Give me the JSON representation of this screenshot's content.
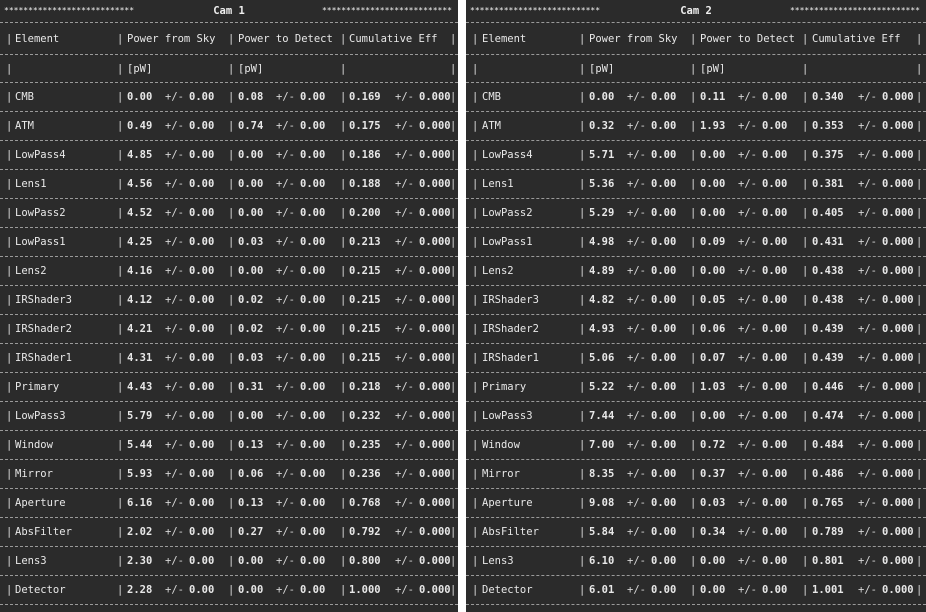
{
  "stars_left": "***************************",
  "stars_right": "***************************",
  "columns": [
    "Element",
    "Power from Sky",
    "Power to Detect",
    "Cumulative Eff"
  ],
  "units": [
    "",
    "[pW]",
    "[pW]",
    ""
  ],
  "pm": "+/-",
  "panels": [
    {
      "title": "Cam 1",
      "rows": [
        {
          "element": "CMB",
          "sky": "0.00",
          "sky_err": "0.00",
          "det": "0.08",
          "det_err": "0.00",
          "eff": "0.169",
          "eff_err": "0.000"
        },
        {
          "element": "ATM",
          "sky": "0.49",
          "sky_err": "0.00",
          "det": "0.74",
          "det_err": "0.00",
          "eff": "0.175",
          "eff_err": "0.000"
        },
        {
          "element": "LowPass4",
          "sky": "4.85",
          "sky_err": "0.00",
          "det": "0.00",
          "det_err": "0.00",
          "eff": "0.186",
          "eff_err": "0.000"
        },
        {
          "element": "Lens1",
          "sky": "4.56",
          "sky_err": "0.00",
          "det": "0.00",
          "det_err": "0.00",
          "eff": "0.188",
          "eff_err": "0.000"
        },
        {
          "element": "LowPass2",
          "sky": "4.52",
          "sky_err": "0.00",
          "det": "0.00",
          "det_err": "0.00",
          "eff": "0.200",
          "eff_err": "0.000"
        },
        {
          "element": "LowPass1",
          "sky": "4.25",
          "sky_err": "0.00",
          "det": "0.03",
          "det_err": "0.00",
          "eff": "0.213",
          "eff_err": "0.000"
        },
        {
          "element": "Lens2",
          "sky": "4.16",
          "sky_err": "0.00",
          "det": "0.00",
          "det_err": "0.00",
          "eff": "0.215",
          "eff_err": "0.000"
        },
        {
          "element": "IRShader3",
          "sky": "4.12",
          "sky_err": "0.00",
          "det": "0.02",
          "det_err": "0.00",
          "eff": "0.215",
          "eff_err": "0.000"
        },
        {
          "element": "IRShader2",
          "sky": "4.21",
          "sky_err": "0.00",
          "det": "0.02",
          "det_err": "0.00",
          "eff": "0.215",
          "eff_err": "0.000"
        },
        {
          "element": "IRShader1",
          "sky": "4.31",
          "sky_err": "0.00",
          "det": "0.03",
          "det_err": "0.00",
          "eff": "0.215",
          "eff_err": "0.000"
        },
        {
          "element": "Primary",
          "sky": "4.43",
          "sky_err": "0.00",
          "det": "0.31",
          "det_err": "0.00",
          "eff": "0.218",
          "eff_err": "0.000"
        },
        {
          "element": "LowPass3",
          "sky": "5.79",
          "sky_err": "0.00",
          "det": "0.00",
          "det_err": "0.00",
          "eff": "0.232",
          "eff_err": "0.000"
        },
        {
          "element": "Window",
          "sky": "5.44",
          "sky_err": "0.00",
          "det": "0.13",
          "det_err": "0.00",
          "eff": "0.235",
          "eff_err": "0.000"
        },
        {
          "element": "Mirror",
          "sky": "5.93",
          "sky_err": "0.00",
          "det": "0.06",
          "det_err": "0.00",
          "eff": "0.236",
          "eff_err": "0.000"
        },
        {
          "element": "Aperture",
          "sky": "6.16",
          "sky_err": "0.00",
          "det": "0.13",
          "det_err": "0.00",
          "eff": "0.768",
          "eff_err": "0.000"
        },
        {
          "element": "AbsFilter",
          "sky": "2.02",
          "sky_err": "0.00",
          "det": "0.27",
          "det_err": "0.00",
          "eff": "0.792",
          "eff_err": "0.000"
        },
        {
          "element": "Lens3",
          "sky": "2.30",
          "sky_err": "0.00",
          "det": "0.00",
          "det_err": "0.00",
          "eff": "0.800",
          "eff_err": "0.000"
        },
        {
          "element": "Detector",
          "sky": "2.28",
          "sky_err": "0.00",
          "det": "0.00",
          "det_err": "0.00",
          "eff": "1.000",
          "eff_err": "0.000"
        }
      ]
    },
    {
      "title": "Cam 2",
      "rows": [
        {
          "element": "CMB",
          "sky": "0.00",
          "sky_err": "0.00",
          "det": "0.11",
          "det_err": "0.00",
          "eff": "0.340",
          "eff_err": "0.000"
        },
        {
          "element": "ATM",
          "sky": "0.32",
          "sky_err": "0.00",
          "det": "1.93",
          "det_err": "0.00",
          "eff": "0.353",
          "eff_err": "0.000"
        },
        {
          "element": "LowPass4",
          "sky": "5.71",
          "sky_err": "0.00",
          "det": "0.00",
          "det_err": "0.00",
          "eff": "0.375",
          "eff_err": "0.000"
        },
        {
          "element": "Lens1",
          "sky": "5.36",
          "sky_err": "0.00",
          "det": "0.00",
          "det_err": "0.00",
          "eff": "0.381",
          "eff_err": "0.000"
        },
        {
          "element": "LowPass2",
          "sky": "5.29",
          "sky_err": "0.00",
          "det": "0.00",
          "det_err": "0.00",
          "eff": "0.405",
          "eff_err": "0.000"
        },
        {
          "element": "LowPass1",
          "sky": "4.98",
          "sky_err": "0.00",
          "det": "0.09",
          "det_err": "0.00",
          "eff": "0.431",
          "eff_err": "0.000"
        },
        {
          "element": "Lens2",
          "sky": "4.89",
          "sky_err": "0.00",
          "det": "0.00",
          "det_err": "0.00",
          "eff": "0.438",
          "eff_err": "0.000"
        },
        {
          "element": "IRShader3",
          "sky": "4.82",
          "sky_err": "0.00",
          "det": "0.05",
          "det_err": "0.00",
          "eff": "0.438",
          "eff_err": "0.000"
        },
        {
          "element": "IRShader2",
          "sky": "4.93",
          "sky_err": "0.00",
          "det": "0.06",
          "det_err": "0.00",
          "eff": "0.439",
          "eff_err": "0.000"
        },
        {
          "element": "IRShader1",
          "sky": "5.06",
          "sky_err": "0.00",
          "det": "0.07",
          "det_err": "0.00",
          "eff": "0.439",
          "eff_err": "0.000"
        },
        {
          "element": "Primary",
          "sky": "5.22",
          "sky_err": "0.00",
          "det": "1.03",
          "det_err": "0.00",
          "eff": "0.446",
          "eff_err": "0.000"
        },
        {
          "element": "LowPass3",
          "sky": "7.44",
          "sky_err": "0.00",
          "det": "0.00",
          "det_err": "0.00",
          "eff": "0.474",
          "eff_err": "0.000"
        },
        {
          "element": "Window",
          "sky": "7.00",
          "sky_err": "0.00",
          "det": "0.72",
          "det_err": "0.00",
          "eff": "0.484",
          "eff_err": "0.000"
        },
        {
          "element": "Mirror",
          "sky": "8.35",
          "sky_err": "0.00",
          "det": "0.37",
          "det_err": "0.00",
          "eff": "0.486",
          "eff_err": "0.000"
        },
        {
          "element": "Aperture",
          "sky": "9.08",
          "sky_err": "0.00",
          "det": "0.03",
          "det_err": "0.00",
          "eff": "0.765",
          "eff_err": "0.000"
        },
        {
          "element": "AbsFilter",
          "sky": "5.84",
          "sky_err": "0.00",
          "det": "0.34",
          "det_err": "0.00",
          "eff": "0.789",
          "eff_err": "0.000"
        },
        {
          "element": "Lens3",
          "sky": "6.10",
          "sky_err": "0.00",
          "det": "0.00",
          "det_err": "0.00",
          "eff": "0.801",
          "eff_err": "0.000"
        },
        {
          "element": "Detector",
          "sky": "6.01",
          "sky_err": "0.00",
          "det": "0.00",
          "det_err": "0.00",
          "eff": "1.001",
          "eff_err": "0.000"
        }
      ]
    }
  ]
}
